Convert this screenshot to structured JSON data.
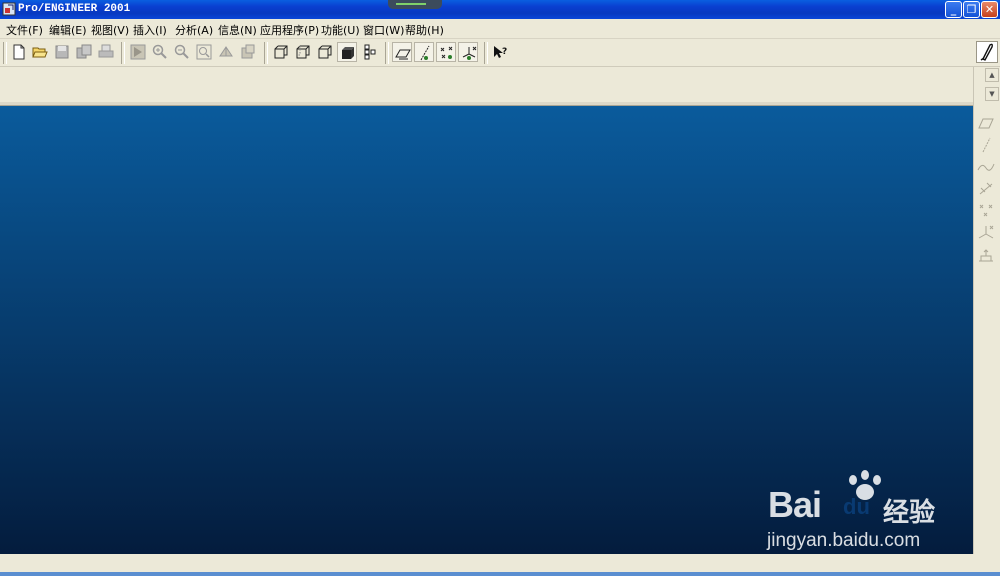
{
  "window": {
    "title": "Pro/ENGINEER 2001",
    "controls": {
      "minimize": "_",
      "restore": "❐",
      "close": "✕"
    }
  },
  "menubar": {
    "items": [
      {
        "label": "文件(F)"
      },
      {
        "label": "编辑(E)"
      },
      {
        "label": "视图(V)"
      },
      {
        "label": "插入(I)"
      },
      {
        "label": "分析(A)"
      },
      {
        "label": "信息(N)"
      },
      {
        "label": "应用程序(P)"
      },
      {
        "label": "功能(U)"
      },
      {
        "label": "窗口(W)"
      },
      {
        "label": "帮助(H)"
      }
    ]
  },
  "toolbar": {
    "icons": [
      "new-file-icon",
      "open-folder-icon",
      "save-icon",
      "save-copy-icon",
      "print-icon",
      "repaint-icon",
      "zoom-in-icon",
      "zoom-out-icon",
      "refit-icon",
      "orient-icon",
      "saved-views-icon",
      "wireframe-icon",
      "hidden-line-icon",
      "no-hidden-icon",
      "shaded-icon",
      "model-tree-icon",
      "datum-planes-icon",
      "datum-axes-icon",
      "datum-points-icon",
      "coordinate-systems-icon",
      "context-help-icon"
    ]
  },
  "right_toolbar": {
    "icons": [
      "datum-plane-tool-icon",
      "datum-axis-tool-icon",
      "datum-curve-tool-icon",
      "datum-point-tool-icon",
      "datum-point-offset-icon",
      "coordinate-system-tool-icon",
      "analysis-feature-icon"
    ]
  },
  "viewport": {
    "background_top": "#0a5b9c",
    "background_bottom": "#041c3d"
  },
  "watermark": {
    "brand": "Bai",
    "paw_text": "du",
    "cn_text": "经验",
    "url": "jingyan.baidu.com"
  }
}
